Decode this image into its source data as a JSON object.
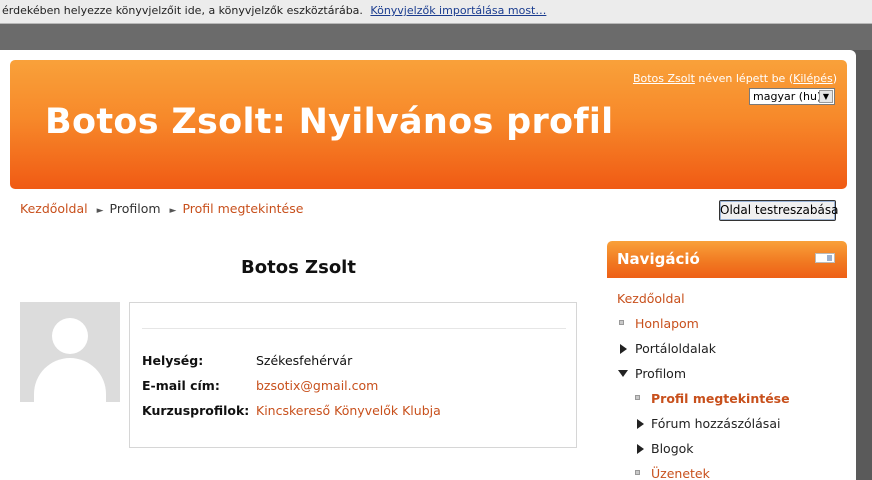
{
  "bookmark_bar": {
    "text": "érdekében helyezze könyvjelzőit ide, a könyvjelzők eszköztárába.",
    "import_link": "Könyvjelzők importálása most…"
  },
  "header": {
    "title": "Botos Zsolt: Nyilvános profil",
    "login_user": "Botos Zsolt",
    "login_text": "néven lépett be (",
    "logout": "Kilépés",
    "login_close": ")",
    "language": "magyar (hu)"
  },
  "breadcrumb": {
    "home": "Kezdőoldal",
    "profile": "Profilom",
    "current": "Profil megtekintése"
  },
  "customize_button": "Oldal testreszabása",
  "profile": {
    "name": "Botos Zsolt",
    "fields": [
      {
        "label": "Helység:",
        "value": "Székesfehérvár"
      },
      {
        "label": "E-mail cím:",
        "value": "bzsotix@gmail.com"
      },
      {
        "label": "Kurzusprofilok:",
        "value": "Kincskereső Könyvelők Klubja"
      }
    ]
  },
  "navigation": {
    "title": "Navigáció",
    "items": [
      {
        "label": "Kezdőoldal"
      },
      {
        "label": "Honlapom"
      },
      {
        "label": "Portáloldalak"
      },
      {
        "label": "Profilom"
      },
      {
        "label": "Profil megtekintése"
      },
      {
        "label": "Fórum hozzászólásai"
      },
      {
        "label": "Blogok"
      },
      {
        "label": "Üzenetek"
      }
    ]
  },
  "colors": {
    "accent": "#f07a22",
    "link": "#c8501c"
  }
}
